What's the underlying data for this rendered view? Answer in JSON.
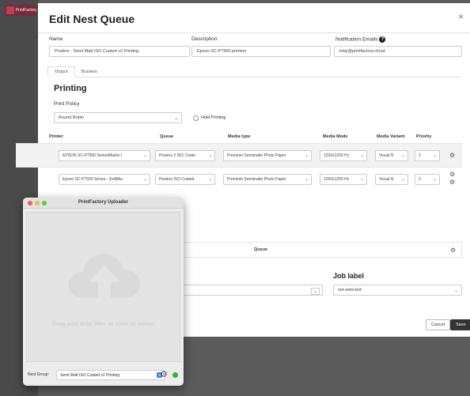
{
  "app": {
    "logo_text": "PrintFactory"
  },
  "modal": {
    "title": "Edit Nest Queue",
    "close_glyph": "×",
    "fields": {
      "name_label": "Name",
      "name_value": "Posters - Semi Matt ISO Coated v2 Printing",
      "description_label": "Description",
      "description_value": "Epson SC-P7500 printers",
      "emails_label": "Notification Emails",
      "emails_value": "toby@printfactory.cloud"
    },
    "tabs": [
      {
        "label": "Output"
      },
      {
        "label": "Buckets"
      }
    ],
    "printing": {
      "title": "Printing",
      "policy_label": "Print Policy",
      "policy_value": "Round Robin",
      "hold_label": "Hold Printing"
    },
    "printers_table": {
      "headers": [
        "Printer",
        "Queue",
        "Media type",
        "Media Mode",
        "Media Variant",
        "Priority"
      ],
      "rows": [
        {
          "printer": "EPSON SC-P7500 Series8Aarle-I",
          "queue": "Posters 2 ISO Coate",
          "media_type": "Premium Semimatte Photo Paper",
          "media_mode": "1200x1200 Hc",
          "media_variant": "Visual N",
          "priority": "1"
        },
        {
          "printer": "Epson SC-P7500 Series - 2nd8Aa",
          "queue": "Posters ISO Coated",
          "media_type": "Premium Semimatte Photo Paper",
          "media_mode": "1200x1200 Hc",
          "media_variant": "Visual N",
          "priority": "2"
        }
      ]
    },
    "buckets_table": {
      "queue_header": "Queue"
    },
    "job_label": {
      "title": "Job label",
      "value": "not selected"
    },
    "cancel_label": "Cancel",
    "save_label": "Save"
  },
  "uploader": {
    "title": "PrintFactory Uploader",
    "drop_text": "Drag and drop files or click to select",
    "nest_group_label": "Nest Group:",
    "nest_group_value": "Semi Matt ISO Coated v2 Printing"
  },
  "colors": {
    "save_bg": "#333333",
    "status_online": "#2fb34a",
    "stepper_blue": "#3d7bf0"
  }
}
